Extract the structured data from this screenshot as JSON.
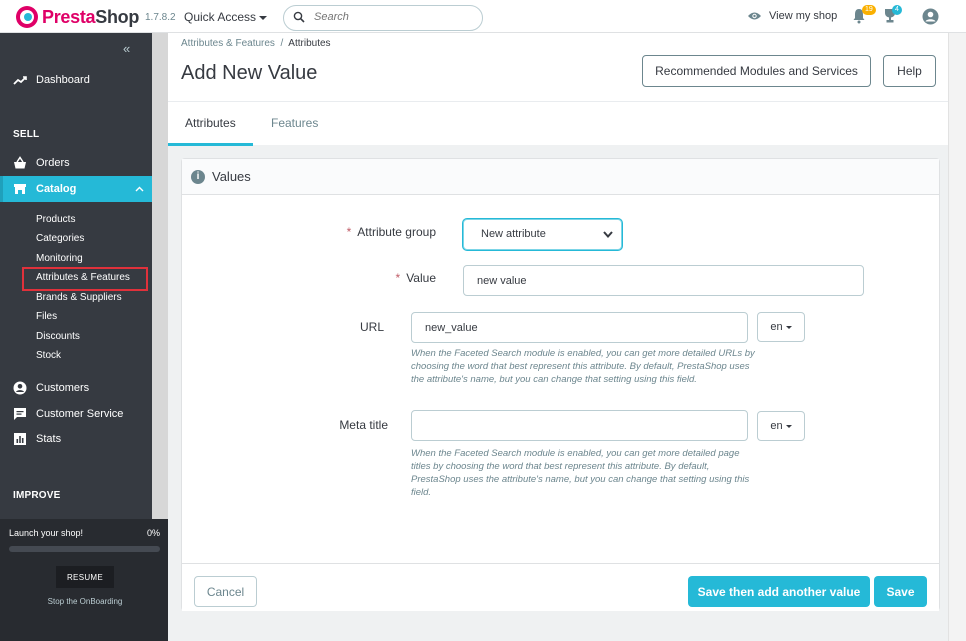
{
  "header": {
    "logo_pre": "Presta",
    "logo_post": "Shop",
    "version": "1.7.8.2",
    "quick_access": "Quick Access",
    "search_placeholder": "Search",
    "view_shop": "View my shop",
    "notifications_count": "19",
    "orders_count": "4"
  },
  "sidebar": {
    "dashboard": "Dashboard",
    "sell_heading": "SELL",
    "orders": "Orders",
    "catalog": "Catalog",
    "catalog_sub": [
      "Products",
      "Categories",
      "Monitoring",
      "Attributes & Features",
      "Brands & Suppliers",
      "Files",
      "Discounts",
      "Stock"
    ],
    "customers": "Customers",
    "customer_service": "Customer Service",
    "stats": "Stats",
    "improve_heading": "IMPROVE"
  },
  "onboarding": {
    "title": "Launch your shop!",
    "progress_label": "0%",
    "progress": 0,
    "resume": "RESUME",
    "stop": "Stop the OnBoarding"
  },
  "page": {
    "breadcrumb_parent": "Attributes & Features",
    "breadcrumb_sep": "/",
    "breadcrumb_current": "Attributes",
    "title": "Add New Value",
    "recommended_button": "Recommended Modules and Services",
    "help_button": "Help"
  },
  "tabs": [
    "Attributes",
    "Features"
  ],
  "card": {
    "title": "Values",
    "attribute_group_label": "Attribute group",
    "attribute_group_value": "New attribute",
    "value_label": "Value",
    "value_value": "new value",
    "url_label": "URL",
    "url_value": "new_value",
    "url_lang": "en",
    "url_help": "When the Faceted Search module is enabled, you can get more detailed URLs by choosing the word that best represent this attribute. By default, PrestaShop uses the attribute's name, but you can change that setting using this field.",
    "meta_label": "Meta title",
    "meta_value": "",
    "meta_lang": "en",
    "meta_help": "When the Faceted Search module is enabled, you can get more detailed page titles by choosing the word that best represent this attribute. By default, PrestaShop uses the attribute's name, but you can change that setting using this field.",
    "required_mark": "*"
  },
  "footer": {
    "cancel": "Cancel",
    "save_add": "Save then add another value",
    "save": "Save"
  },
  "colors": {
    "accent": "#25b9d7",
    "brand": "#df0067",
    "sidebar": "#363a41",
    "highlight": "#e0313b"
  }
}
